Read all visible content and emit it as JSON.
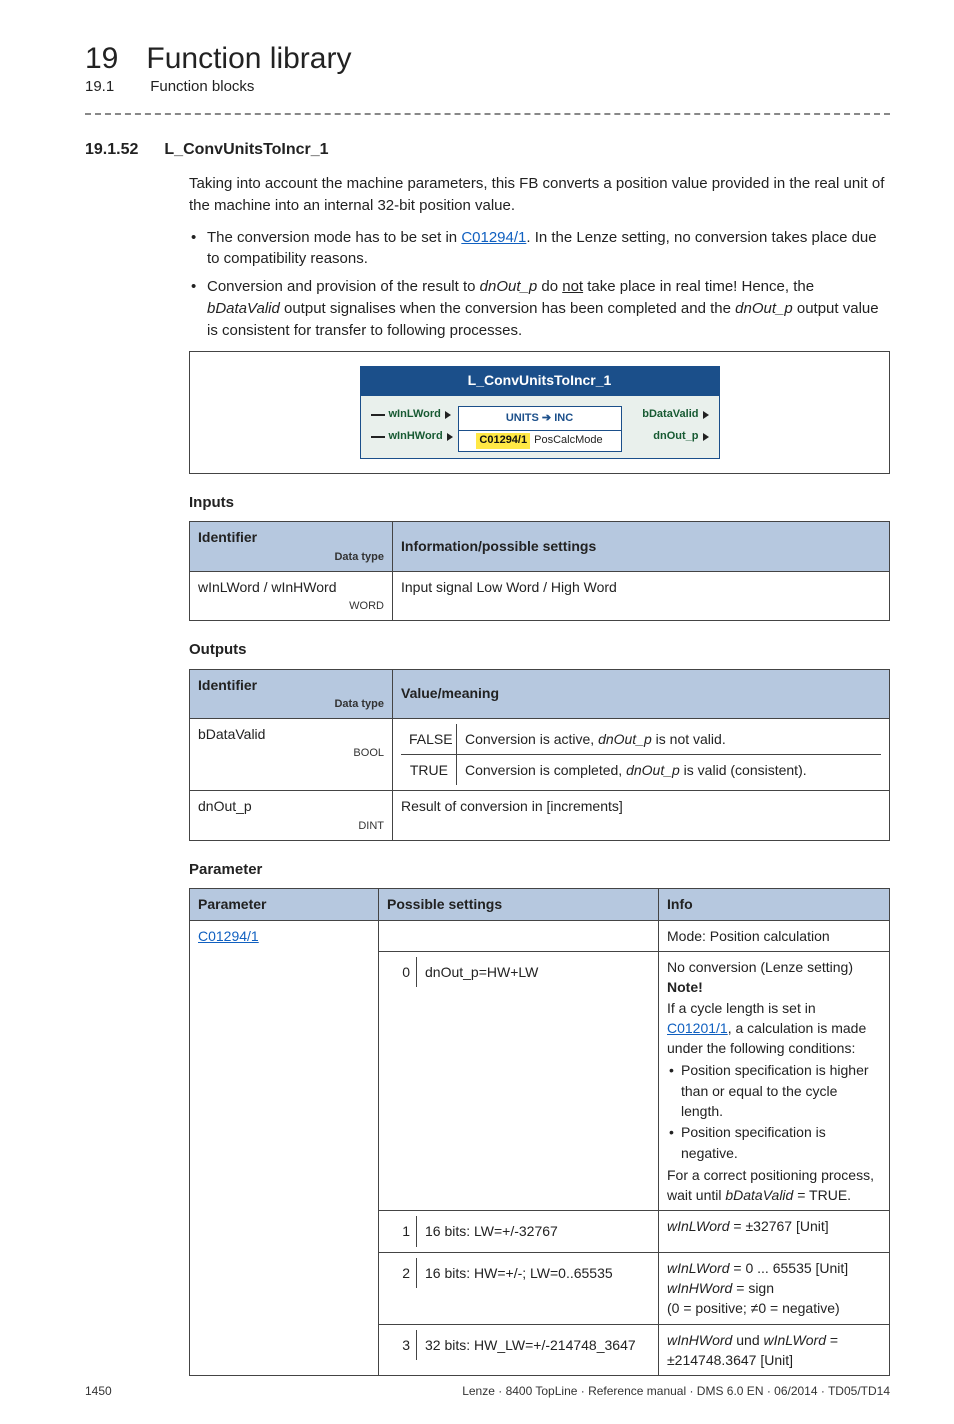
{
  "chapter": {
    "num": "19",
    "title": "Function library"
  },
  "subsection": {
    "num": "19.1",
    "title": "Function blocks"
  },
  "section": {
    "num": "19.1.52",
    "title": "L_ConvUnitsToIncr_1"
  },
  "intro": "Taking into account the machine parameters, this FB converts a position value provided in the real unit of the machine into an internal 32-bit position value.",
  "bullets": {
    "b1_a": "The conversion mode has to be set in ",
    "b1_link": "C01294/1",
    "b1_b": ". In the Lenze setting, no conversion takes place due to compatibility reasons.",
    "b2_a": "Conversion and provision of the result to ",
    "b2_i1": "dnOut_p",
    "b2_b": " do ",
    "b2_not": "not",
    "b2_c": " take place in real time! Hence, the ",
    "b2_i2": "bDataValid",
    "b2_d": " output signalises when the conversion has been completed and the ",
    "b2_i3": "dnOut_p",
    "b2_e": " output value is consistent for transfer to following processes."
  },
  "diagram": {
    "title": "L_ConvUnitsToIncr_1",
    "in1": "wInLWord",
    "in2": "wInHWord",
    "out1": "bDataValid",
    "out2": "dnOut_p",
    "center_top_left": "UNITS",
    "center_top_arrow": "➔",
    "center_top_right": "INC",
    "center_bot_code": "C01294/1",
    "center_bot_label": "PosCalcMode"
  },
  "inputs": {
    "head": "Inputs",
    "th1": "Identifier",
    "th1_sub": "Data type",
    "th2": "Information/possible settings",
    "r1_id": "wInLWord / wInHWord",
    "r1_type": "WORD",
    "r1_info": "Input signal Low Word / High Word"
  },
  "outputs": {
    "head": "Outputs",
    "th1": "Identifier",
    "th1_sub": "Data type",
    "th2": "Value/meaning",
    "r1_id": "bDataValid",
    "r1_type": "BOOL",
    "r1_k1": "FALSE",
    "r1_v1a": "Conversion is active, ",
    "r1_v1i": "dnOut_p",
    "r1_v1b": " is not valid.",
    "r1_k2": "TRUE",
    "r1_v2a": "Conversion is completed, ",
    "r1_v2i": "dnOut_p",
    "r1_v2b": " is valid (consistent).",
    "r2_id": "dnOut_p",
    "r2_type": "DINT",
    "r2_info": "Result of conversion in [increments]"
  },
  "param": {
    "head": "Parameter",
    "th1": "Parameter",
    "th2": "Possible settings",
    "th3": "Info",
    "row_link": "C01294/1",
    "mode_label": "Mode: Position calculation",
    "s0_k": "0",
    "s0_v": "dnOut_p=HW+LW",
    "s1_k": "1",
    "s1_v": "16 bits: LW=+/-32767",
    "s2_k": "2",
    "s2_v": "16 bits: HW=+/-; LW=0..65535",
    "s3_k": "3",
    "s3_v": "32 bits: HW_LW=+/-214748_3647",
    "i0_l1": "No conversion (Lenze setting)",
    "i0_note": "Note!",
    "i0_l2a": "If a cycle length is set in ",
    "i0_l2link": "C01201/1",
    "i0_l2b": ", a calculation is made under the following conditions:",
    "i0_b1": "Position specification is higher than or equal to the cycle length.",
    "i0_b2": "Position specification is negative.",
    "i0_l3a": "For a correct positioning process, wait until ",
    "i0_l3i": "bDataValid",
    "i0_l3b": " = TRUE.",
    "i1_a": "wInLWord",
    "i1_b": " = ±32767 [Unit]",
    "i2_a": "wInLWord",
    "i2_b": " = 0 ... 65535 [Unit]",
    "i2_c": "wInHWord",
    "i2_d": " = sign",
    "i2_e": "(0 = positive; ≠0 = negative)",
    "i3_a": "wInHWord",
    "i3_mid": " und ",
    "i3_b": "wInLWord",
    "i3_c": " = ±214748.3647 [Unit]"
  },
  "footer": {
    "page": "1450",
    "doc": "Lenze · 8400 TopLine · Reference manual · DMS 6.0 EN · 06/2014 · TD05/TD14"
  }
}
